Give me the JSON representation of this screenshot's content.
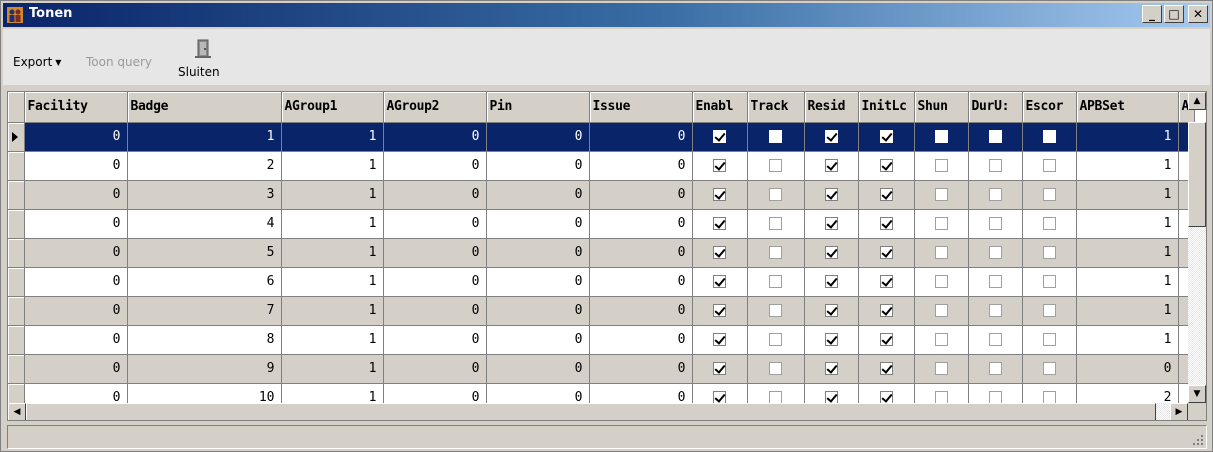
{
  "window": {
    "title": "Tonen",
    "controls": {
      "minimize": "_",
      "maximize": "□",
      "close": "✕"
    }
  },
  "toolbar": {
    "export_label": "Export",
    "export_caret": "▼",
    "query_label": "Toon query",
    "close_label": "Sluiten"
  },
  "grid": {
    "columns": [
      "Facility",
      "Badge",
      "AGroup1",
      "AGroup2",
      "Pin",
      "Issue",
      "Enabl",
      "Track",
      "Resid",
      "InitLc",
      "Shun",
      "DurU:",
      "Escor",
      "APBSet",
      "A"
    ],
    "rows": [
      {
        "selected": true,
        "facility": "0",
        "badge": "1",
        "agroup1": "1",
        "agroup2": "0",
        "pin": "0",
        "issue": "0",
        "enabl": true,
        "track": false,
        "resid": true,
        "initlc": true,
        "shun": false,
        "duru": false,
        "escor": false,
        "apbset": "1"
      },
      {
        "selected": false,
        "facility": "0",
        "badge": "2",
        "agroup1": "1",
        "agroup2": "0",
        "pin": "0",
        "issue": "0",
        "enabl": true,
        "track": false,
        "resid": true,
        "initlc": true,
        "shun": false,
        "duru": false,
        "escor": false,
        "apbset": "1"
      },
      {
        "selected": false,
        "facility": "0",
        "badge": "3",
        "agroup1": "1",
        "agroup2": "0",
        "pin": "0",
        "issue": "0",
        "enabl": true,
        "track": false,
        "resid": true,
        "initlc": true,
        "shun": false,
        "duru": false,
        "escor": false,
        "apbset": "1"
      },
      {
        "selected": false,
        "facility": "0",
        "badge": "4",
        "agroup1": "1",
        "agroup2": "0",
        "pin": "0",
        "issue": "0",
        "enabl": true,
        "track": false,
        "resid": true,
        "initlc": true,
        "shun": false,
        "duru": false,
        "escor": false,
        "apbset": "1"
      },
      {
        "selected": false,
        "facility": "0",
        "badge": "5",
        "agroup1": "1",
        "agroup2": "0",
        "pin": "0",
        "issue": "0",
        "enabl": true,
        "track": false,
        "resid": true,
        "initlc": true,
        "shun": false,
        "duru": false,
        "escor": false,
        "apbset": "1"
      },
      {
        "selected": false,
        "facility": "0",
        "badge": "6",
        "agroup1": "1",
        "agroup2": "0",
        "pin": "0",
        "issue": "0",
        "enabl": true,
        "track": false,
        "resid": true,
        "initlc": true,
        "shun": false,
        "duru": false,
        "escor": false,
        "apbset": "1"
      },
      {
        "selected": false,
        "facility": "0",
        "badge": "7",
        "agroup1": "1",
        "agroup2": "0",
        "pin": "0",
        "issue": "0",
        "enabl": true,
        "track": false,
        "resid": true,
        "initlc": true,
        "shun": false,
        "duru": false,
        "escor": false,
        "apbset": "1"
      },
      {
        "selected": false,
        "facility": "0",
        "badge": "8",
        "agroup1": "1",
        "agroup2": "0",
        "pin": "0",
        "issue": "0",
        "enabl": true,
        "track": false,
        "resid": true,
        "initlc": true,
        "shun": false,
        "duru": false,
        "escor": false,
        "apbset": "1"
      },
      {
        "selected": false,
        "facility": "0",
        "badge": "9",
        "agroup1": "1",
        "agroup2": "0",
        "pin": "0",
        "issue": "0",
        "enabl": true,
        "track": false,
        "resid": true,
        "initlc": true,
        "shun": false,
        "duru": false,
        "escor": false,
        "apbset": "0"
      },
      {
        "selected": false,
        "facility": "0",
        "badge": "10",
        "agroup1": "1",
        "agroup2": "0",
        "pin": "0",
        "issue": "0",
        "enabl": true,
        "track": false,
        "resid": true,
        "initlc": true,
        "shun": false,
        "duru": false,
        "escor": false,
        "apbset": "2"
      }
    ]
  },
  "colors": {
    "title_gradient_start": "#0a246a",
    "title_gradient_end": "#a6caf0",
    "selection": "#0a246a",
    "alt_row": "#d4d0c8",
    "chrome": "#d4d0c8"
  },
  "icons": {
    "title": "people-icon",
    "close_tool": "exit-door-icon",
    "row_indicator": "current-row-arrow-icon"
  }
}
